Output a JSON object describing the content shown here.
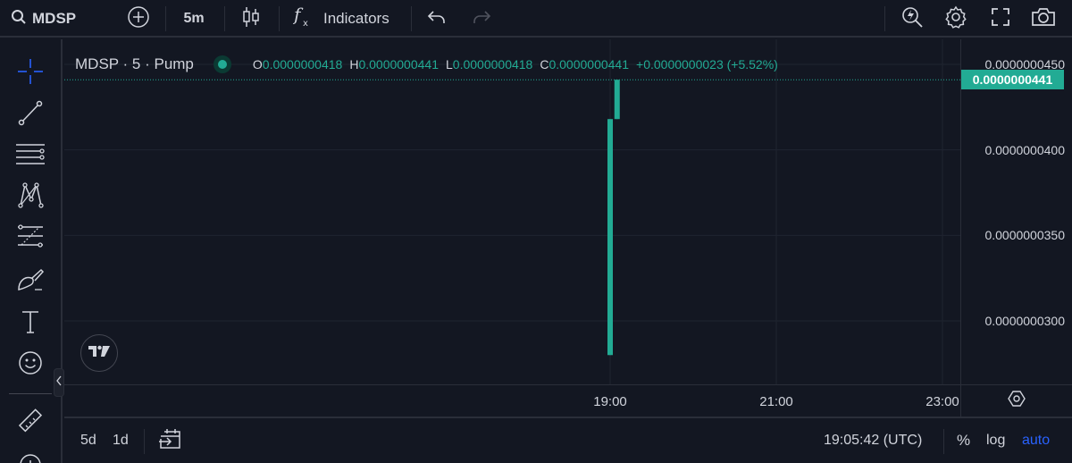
{
  "toolbar": {
    "symbol": "MDSP",
    "interval": "5m",
    "indicators_label": "Indicators",
    "icons": [
      "search-icon",
      "add-symbol-icon",
      "candles-icon",
      "fx-icon",
      "undo-icon",
      "redo-icon",
      "quick-search-icon",
      "settings-icon",
      "fullscreen-icon",
      "snapshot-icon"
    ]
  },
  "left_tools": [
    "crosshair-icon",
    "trendline-icon",
    "horizontal-lines-icon",
    "pattern-icon",
    "fib-icon",
    "brush-icon",
    "text-icon",
    "emoji-icon",
    "ruler-icon"
  ],
  "legend": {
    "title": "MDSP · 5 · Pump",
    "o_key": "O",
    "o_val": "0.0000000418",
    "h_key": "H",
    "h_val": "0.0000000441",
    "l_key": "L",
    "l_val": "0.0000000418",
    "c_key": "C",
    "c_val": "0.0000000441",
    "change": "+0.0000000023 (+5.52%)",
    "status_color": "#22ab94"
  },
  "price_axis": {
    "ticks": [
      "0.0000000450",
      "0.0000000400",
      "0.0000000350",
      "0.0000000300"
    ],
    "last_price": "0.0000000441",
    "last_price_color": "#22ab94"
  },
  "time_axis": {
    "ticks": [
      "19:00",
      "21:00",
      "23:00"
    ]
  },
  "bottom_bar": {
    "range_5d": "5d",
    "range_1d": "1d",
    "clock": "19:05:42 (UTC)",
    "percent": "%",
    "log": "log",
    "auto": "auto"
  },
  "chart_data": {
    "type": "candlestick",
    "symbol": "MDSP",
    "interval": "5",
    "up_color": "#22ab94",
    "ylim": [
      2.8e-08,
      4.58e-08
    ],
    "time_range": [
      "16:40",
      "23:40"
    ],
    "candles": [
      {
        "time": "19:00",
        "open": 2.8e-08,
        "high": 4.18e-08,
        "low": 2.8e-08,
        "close": 4.18e-08
      },
      {
        "time": "19:05",
        "open": 4.18e-08,
        "high": 4.41e-08,
        "low": 4.18e-08,
        "close": 4.41e-08
      }
    ],
    "last_price": 4.41e-08
  }
}
